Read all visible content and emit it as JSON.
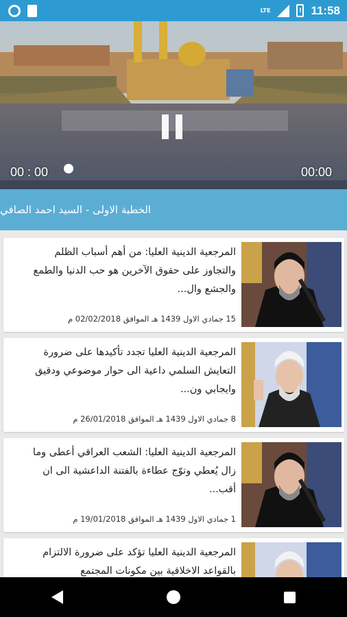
{
  "status_bar": {
    "network": "LTE",
    "time": "11:58"
  },
  "player": {
    "elapsed": "00 : 00",
    "duration": "00:00",
    "progress": 0
  },
  "now_playing": {
    "title": "الخطبة الاولى  - السيد احمد الصافي"
  },
  "articles": [
    {
      "headline": "المرجعية الدينية العليا: من أهم أسباب الظلم والتجاوز على حقوق الآخرين هو حب الدنيا والطمع والجشع وال...",
      "hijri": "15 جمادي الاول 1439",
      "greg_label": "هـ الموافق",
      "greg": "02/02/2018",
      "suffix": "م",
      "thumb": "portrait-black-turban"
    },
    {
      "headline": "المرجعية الدينية العليا تجدد تأكيدها على ضرورة التعايش السلمي داعية الى حوار موضوعي ودقيق وايجابي ون...",
      "hijri": "8 جمادي الاول 1439",
      "greg_label": "هـ الموافق",
      "greg": "26/01/2018",
      "suffix": "م",
      "thumb": "portrait-white-turban"
    },
    {
      "headline": "المرجعية الدينية العليا: الشعب العراقي أعطى وما زال يُعطي وتوّج عطاءة بالفتنة الداعشية الى ان أقب...",
      "hijri": "1 جمادي الاول 1439",
      "greg_label": "هـ الموافق",
      "greg": "19/01/2018",
      "suffix": "م",
      "thumb": "portrait-black-turban"
    },
    {
      "headline": "المرجعية الدينية العليا تؤكد على ضرورة الالتزام بالقواعد الاخلاقية بين مكونات المجتمع",
      "hijri": "",
      "greg_label": "",
      "greg": "",
      "suffix": "",
      "thumb": "portrait-white-turban"
    }
  ],
  "colors": {
    "status_bar": "#2d9bd2",
    "title_bar": "#5cadd4",
    "background": "#e9e9e9"
  }
}
